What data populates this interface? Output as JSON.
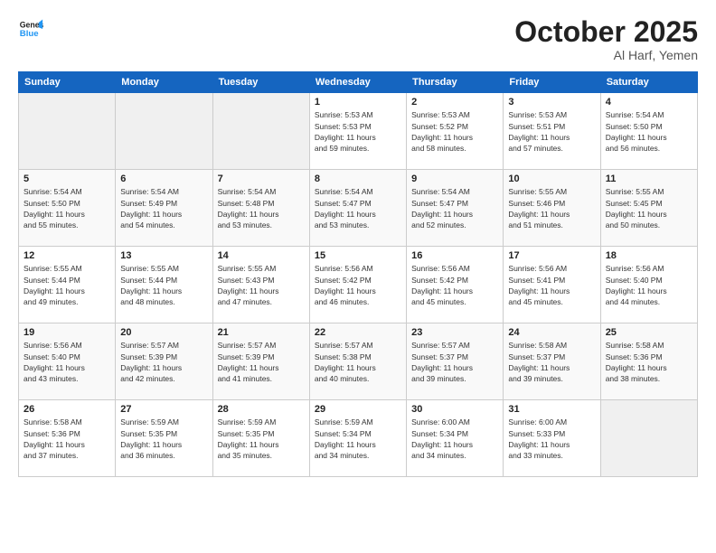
{
  "header": {
    "logo_line1": "General",
    "logo_line2": "Blue",
    "month": "October 2025",
    "location": "Al Harf, Yemen"
  },
  "weekdays": [
    "Sunday",
    "Monday",
    "Tuesday",
    "Wednesday",
    "Thursday",
    "Friday",
    "Saturday"
  ],
  "weeks": [
    [
      {
        "day": "",
        "info": ""
      },
      {
        "day": "",
        "info": ""
      },
      {
        "day": "",
        "info": ""
      },
      {
        "day": "1",
        "info": "Sunrise: 5:53 AM\nSunset: 5:53 PM\nDaylight: 11 hours\nand 59 minutes."
      },
      {
        "day": "2",
        "info": "Sunrise: 5:53 AM\nSunset: 5:52 PM\nDaylight: 11 hours\nand 58 minutes."
      },
      {
        "day": "3",
        "info": "Sunrise: 5:53 AM\nSunset: 5:51 PM\nDaylight: 11 hours\nand 57 minutes."
      },
      {
        "day": "4",
        "info": "Sunrise: 5:54 AM\nSunset: 5:50 PM\nDaylight: 11 hours\nand 56 minutes."
      }
    ],
    [
      {
        "day": "5",
        "info": "Sunrise: 5:54 AM\nSunset: 5:50 PM\nDaylight: 11 hours\nand 55 minutes."
      },
      {
        "day": "6",
        "info": "Sunrise: 5:54 AM\nSunset: 5:49 PM\nDaylight: 11 hours\nand 54 minutes."
      },
      {
        "day": "7",
        "info": "Sunrise: 5:54 AM\nSunset: 5:48 PM\nDaylight: 11 hours\nand 53 minutes."
      },
      {
        "day": "8",
        "info": "Sunrise: 5:54 AM\nSunset: 5:47 PM\nDaylight: 11 hours\nand 53 minutes."
      },
      {
        "day": "9",
        "info": "Sunrise: 5:54 AM\nSunset: 5:47 PM\nDaylight: 11 hours\nand 52 minutes."
      },
      {
        "day": "10",
        "info": "Sunrise: 5:55 AM\nSunset: 5:46 PM\nDaylight: 11 hours\nand 51 minutes."
      },
      {
        "day": "11",
        "info": "Sunrise: 5:55 AM\nSunset: 5:45 PM\nDaylight: 11 hours\nand 50 minutes."
      }
    ],
    [
      {
        "day": "12",
        "info": "Sunrise: 5:55 AM\nSunset: 5:44 PM\nDaylight: 11 hours\nand 49 minutes."
      },
      {
        "day": "13",
        "info": "Sunrise: 5:55 AM\nSunset: 5:44 PM\nDaylight: 11 hours\nand 48 minutes."
      },
      {
        "day": "14",
        "info": "Sunrise: 5:55 AM\nSunset: 5:43 PM\nDaylight: 11 hours\nand 47 minutes."
      },
      {
        "day": "15",
        "info": "Sunrise: 5:56 AM\nSunset: 5:42 PM\nDaylight: 11 hours\nand 46 minutes."
      },
      {
        "day": "16",
        "info": "Sunrise: 5:56 AM\nSunset: 5:42 PM\nDaylight: 11 hours\nand 45 minutes."
      },
      {
        "day": "17",
        "info": "Sunrise: 5:56 AM\nSunset: 5:41 PM\nDaylight: 11 hours\nand 45 minutes."
      },
      {
        "day": "18",
        "info": "Sunrise: 5:56 AM\nSunset: 5:40 PM\nDaylight: 11 hours\nand 44 minutes."
      }
    ],
    [
      {
        "day": "19",
        "info": "Sunrise: 5:56 AM\nSunset: 5:40 PM\nDaylight: 11 hours\nand 43 minutes."
      },
      {
        "day": "20",
        "info": "Sunrise: 5:57 AM\nSunset: 5:39 PM\nDaylight: 11 hours\nand 42 minutes."
      },
      {
        "day": "21",
        "info": "Sunrise: 5:57 AM\nSunset: 5:39 PM\nDaylight: 11 hours\nand 41 minutes."
      },
      {
        "day": "22",
        "info": "Sunrise: 5:57 AM\nSunset: 5:38 PM\nDaylight: 11 hours\nand 40 minutes."
      },
      {
        "day": "23",
        "info": "Sunrise: 5:57 AM\nSunset: 5:37 PM\nDaylight: 11 hours\nand 39 minutes."
      },
      {
        "day": "24",
        "info": "Sunrise: 5:58 AM\nSunset: 5:37 PM\nDaylight: 11 hours\nand 39 minutes."
      },
      {
        "day": "25",
        "info": "Sunrise: 5:58 AM\nSunset: 5:36 PM\nDaylight: 11 hours\nand 38 minutes."
      }
    ],
    [
      {
        "day": "26",
        "info": "Sunrise: 5:58 AM\nSunset: 5:36 PM\nDaylight: 11 hours\nand 37 minutes."
      },
      {
        "day": "27",
        "info": "Sunrise: 5:59 AM\nSunset: 5:35 PM\nDaylight: 11 hours\nand 36 minutes."
      },
      {
        "day": "28",
        "info": "Sunrise: 5:59 AM\nSunset: 5:35 PM\nDaylight: 11 hours\nand 35 minutes."
      },
      {
        "day": "29",
        "info": "Sunrise: 5:59 AM\nSunset: 5:34 PM\nDaylight: 11 hours\nand 34 minutes."
      },
      {
        "day": "30",
        "info": "Sunrise: 6:00 AM\nSunset: 5:34 PM\nDaylight: 11 hours\nand 34 minutes."
      },
      {
        "day": "31",
        "info": "Sunrise: 6:00 AM\nSunset: 5:33 PM\nDaylight: 11 hours\nand 33 minutes."
      },
      {
        "day": "",
        "info": ""
      }
    ]
  ]
}
